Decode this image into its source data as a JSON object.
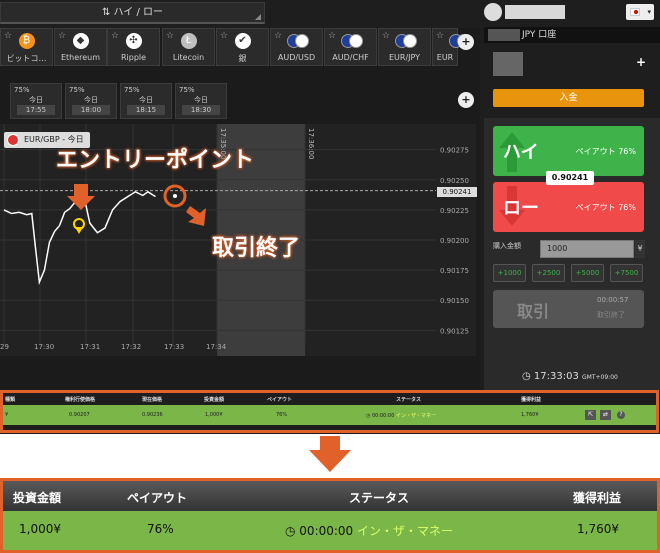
{
  "mode_label": "⇅ ハイ / ロー",
  "assets": [
    {
      "name": "ビットコ…",
      "color": "#f7931a",
      "glyph": "₿"
    },
    {
      "name": "Ethereum",
      "color": "#ffffff",
      "glyph": "◆"
    },
    {
      "name": "Ripple",
      "color": "#ffffff",
      "glyph": "✣"
    },
    {
      "name": "Litecoin",
      "color": "#bfbfbf",
      "glyph": "Ł"
    },
    {
      "name": "銀",
      "color": "#ffffff",
      "glyph": "✔"
    },
    {
      "name": "AUD/USD",
      "color": "#1f3d99",
      "glyph": ""
    },
    {
      "name": "AUD/CHF",
      "color": "#1f3d99",
      "glyph": ""
    },
    {
      "name": "EUR/JPY",
      "color": "#1f3d99",
      "glyph": ""
    },
    {
      "name": "EUR",
      "color": "#1f3d99",
      "glyph": ""
    }
  ],
  "asset_plus": "+",
  "time_slots": [
    {
      "pct": "75%",
      "day": "今日",
      "time": "17:55"
    },
    {
      "pct": "75%",
      "day": "今日",
      "time": "18:00"
    },
    {
      "pct": "75%",
      "day": "今日",
      "time": "18:15"
    },
    {
      "pct": "75%",
      "day": "今日",
      "time": "18:30"
    }
  ],
  "time_plus": "+",
  "chart": {
    "pair_label": "EUR/GBP - 今日",
    "current_price": "0.90241",
    "vertical_labels": [
      "17:35:00",
      "17:36:00"
    ]
  },
  "chart_data": {
    "type": "line",
    "x_ticks": [
      "29",
      "17:30",
      "17:31",
      "17:32",
      "17:33",
      "17:34"
    ],
    "y_ticks": [
      "0.90275",
      "0.90250",
      "0.90225",
      "0.90200",
      "0.90175",
      "0.90150",
      "0.90125"
    ],
    "ylim": [
      0.90112,
      0.90288
    ],
    "series": [
      {
        "values": [
          [
            0,
            0.90225
          ],
          [
            0.15,
            0.90222
          ],
          [
            0.3,
            0.90223
          ],
          [
            0.45,
            0.90221
          ],
          [
            0.55,
            0.90222
          ],
          [
            0.62,
            0.90195
          ],
          [
            0.7,
            0.90165
          ],
          [
            0.8,
            0.90175
          ],
          [
            0.9,
            0.90198
          ],
          [
            1.0,
            0.90207
          ],
          [
            1.1,
            0.90212
          ],
          [
            1.2,
            0.90223
          ],
          [
            1.3,
            0.90226
          ],
          [
            1.4,
            0.90231
          ],
          [
            1.5,
            0.90236
          ],
          [
            1.6,
            0.90233
          ],
          [
            1.7,
            0.90214
          ],
          [
            1.85,
            0.90206
          ],
          [
            2.0,
            0.9021
          ],
          [
            2.15,
            0.90225
          ],
          [
            2.3,
            0.90232
          ],
          [
            2.45,
            0.90236
          ],
          [
            2.6,
            0.9024
          ],
          [
            2.75,
            0.90237
          ],
          [
            2.85,
            0.9024
          ],
          [
            3.0,
            0.90236
          ]
        ]
      }
    ]
  },
  "annotations": {
    "entry": "エントリーポイント",
    "end": "取引終了"
  },
  "account": {
    "label": "JPY 口座",
    "deposit": "入金",
    "plus": "+",
    "flag_caret": "▾"
  },
  "trade_panel": {
    "high_label": "ハイ",
    "low_label": "ロー",
    "payout_high": "ペイアウト 76%",
    "payout_low": "ペイアウト 76%",
    "mid_price": "0.90241",
    "amount_label": "購入金額",
    "amount_value": "1000",
    "currency": "¥",
    "quick": [
      "+1000",
      "+2500",
      "+5000",
      "+7500"
    ],
    "trade_label": "取引",
    "timer": "00:00:57",
    "timer_sub": "取引終了"
  },
  "clock": {
    "time": "17:33:03",
    "tz": "GMT+09:00"
  },
  "trades_table": {
    "headers": [
      "種類",
      "権利行使価格",
      "現在価格",
      "投資金額",
      "ペイアウト",
      "ステータス",
      "獲得利益"
    ],
    "row": {
      "type": "¥",
      "strike": "0.90207",
      "current": "0.90236",
      "invest": "1,000¥",
      "payout": "76%",
      "time": "00:00:00",
      "status": "イン・ザ・マネー",
      "profit": "1,760¥"
    }
  },
  "zoom_table": {
    "headers": [
      "投資金額",
      "ペイアウト",
      "ステータス",
      "獲得利益"
    ],
    "row": {
      "invest": "1,000¥",
      "payout": "76%",
      "time": "00:00:00",
      "status": "イン・ザ・マネー",
      "profit": "1,760¥"
    }
  },
  "colors": {
    "accent": "#e0622a",
    "green": "#3db34a",
    "red": "#f04a4a",
    "row_green": "#7ab648",
    "deposit": "#e8940c"
  }
}
